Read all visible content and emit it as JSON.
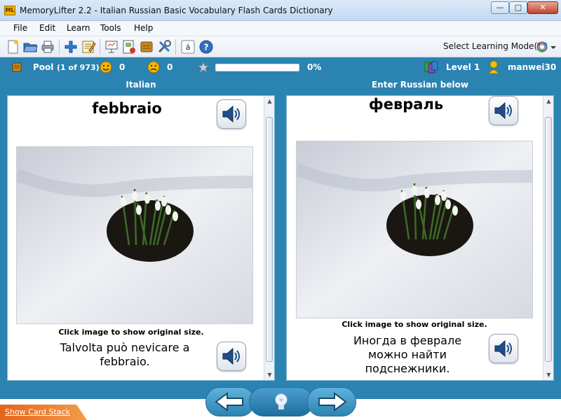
{
  "window": {
    "app_icon_label": "ML",
    "title": "MemoryLifter 2.2 - Italian Russian Basic Vocabulary Flash Cards Dictionary",
    "minimize": "—",
    "maximize": "□",
    "close": "✕"
  },
  "menu": {
    "items": [
      {
        "label": "File"
      },
      {
        "label": "Edit"
      },
      {
        "label": "Learn"
      },
      {
        "label": "Tools"
      },
      {
        "label": "Help"
      }
    ]
  },
  "toolbar": {
    "icons": [
      "new-icon",
      "open-icon",
      "print-icon",
      "add-icon",
      "edit-icon",
      "presentation-icon",
      "card-icon",
      "module-icon",
      "tools-icon",
      "character-icon",
      "help-icon"
    ],
    "select_mode_label": "Select Learning Mode(s)",
    "character_glyph": "á",
    "help_glyph": "?"
  },
  "status": {
    "pool_label": "Pool",
    "pool_count": "(1 of 973)",
    "correct_count": "0",
    "wrong_count": "0",
    "progress_percent": "0%",
    "progress_value": 0,
    "level": "Level 1",
    "user": "manwei30"
  },
  "question": {
    "header": "Italian",
    "word": "febbraio",
    "caption": "Click image to show original size.",
    "sentence": "Talvolta può nevicare a febbraio."
  },
  "answer": {
    "header": "Enter Russian below",
    "word": "февраль",
    "caption": "Click image to show original size.",
    "sentence": "Иногда в феврале можно найти подснежники."
  },
  "bottom": {
    "show_card_stack": "Show Card Stack"
  },
  "colors": {
    "accent": "#2b83b1",
    "orange_tab": "#e5651c"
  }
}
